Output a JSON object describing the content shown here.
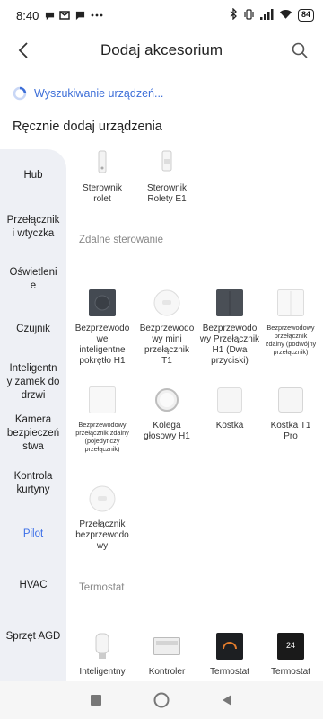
{
  "status": {
    "time": "8:40",
    "battery": "84"
  },
  "header": {
    "title": "Dodaj akcesorium"
  },
  "searching": "Wyszukiwanie urządzeń...",
  "manual_title": "Ręcznie dodaj urządzenia",
  "sidebar": {
    "items": [
      {
        "label": "Hub"
      },
      {
        "label": "Przełącznik\ni wtyczka"
      },
      {
        "label": "Oświetleni\ne"
      },
      {
        "label": "Czujnik"
      },
      {
        "label": "Inteligentn\ny zamek do\ndrzwi"
      },
      {
        "label": "Kamera\nbezpieczeń\nstwa"
      },
      {
        "label": "Kontrola\nkurtyny"
      },
      {
        "label": "Pilot"
      },
      {
        "label": "HVAC"
      },
      {
        "label": "Sprzęt AGD"
      }
    ],
    "active": "Pilot"
  },
  "sections": {
    "curtain": {
      "devices": [
        {
          "label": "Sterownik\nrolet"
        },
        {
          "label": "Sterownik\nRolety E1"
        }
      ]
    },
    "remote": {
      "title": "Zdalne sterowanie",
      "devices": [
        {
          "label": "Bezprzewodo\nwe\ninteligentne\npokrętło H1"
        },
        {
          "label": "Bezprzewodo\nwy mini\nprzełącznik\nT1"
        },
        {
          "label": "Bezprzewodo\nwy Przełącznik\nH1 (Dwa\nprzyciski)"
        },
        {
          "label": "Bezprzewodowy\nprzełącznik\nzdalny (podwójny\nprzełącznik)"
        },
        {
          "label": "Bezprzewodowy\nprzełącznik zdalny\n(pojedynczy\nprzełącznik)"
        },
        {
          "label": "Kolega\ngłosowy H1"
        },
        {
          "label": "Kostka"
        },
        {
          "label": "Kostka T1\nPro"
        },
        {
          "label": "Przełącznik\nbezprzewodo\nwy"
        }
      ]
    },
    "thermostat": {
      "title": "Termostat",
      "devices": [
        {
          "label": "Inteligentny"
        },
        {
          "label": "Kontroler"
        },
        {
          "label": "Termostat"
        },
        {
          "label": "Termostat"
        }
      ],
      "display_value": "24"
    }
  },
  "colors": {
    "accent": "#3a6ee8",
    "sidebar_bg": "#eef0f5",
    "section_title": "#888888"
  }
}
